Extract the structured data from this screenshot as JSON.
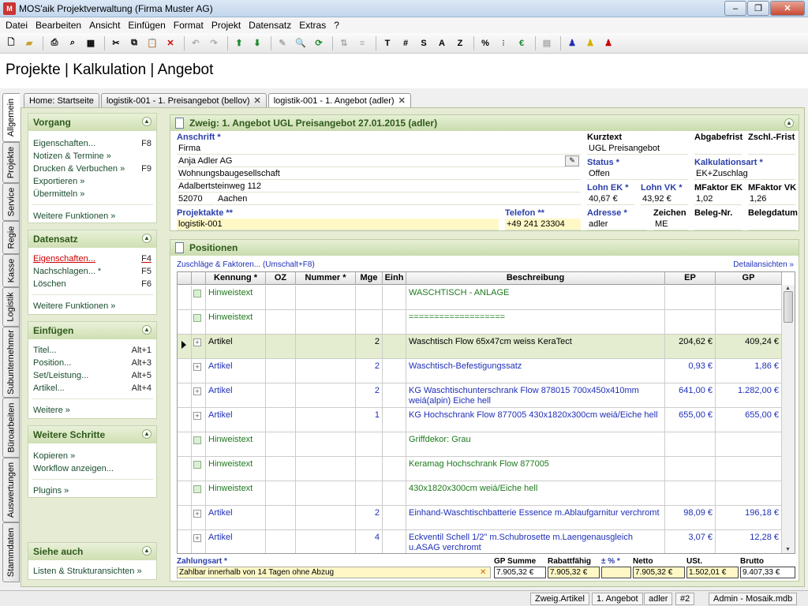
{
  "window": {
    "title": "MOS'aik Projektverwaltung (Firma Muster AG)"
  },
  "menu": [
    "Datei",
    "Bearbeiten",
    "Ansicht",
    "Einfügen",
    "Format",
    "Projekt",
    "Datensatz",
    "Extras",
    "?"
  ],
  "toolbar": {
    "t_btn": "T",
    "hash_btn": "#",
    "s_btn": "S",
    "a_btn": "A",
    "z_btn": "Z",
    "percent_btn": "%"
  },
  "page": {
    "heading": "Projekte | Kalkulation | Angebot"
  },
  "vtabs": [
    "Allgemein",
    "Projekte",
    "Service",
    "Regie",
    "Kasse",
    "Logistik",
    "Subunternehmer",
    "Büroarbeiten",
    "Auswertungen",
    "Stammdaten"
  ],
  "tabs": [
    {
      "label": "Home: Startseite"
    },
    {
      "label": "logistik-001 - 1. Preisangebot (bellov)"
    },
    {
      "label": "logistik-001 - 1. Angebot (adler)"
    }
  ],
  "left": {
    "vorgang": {
      "title": "Vorgang",
      "items": [
        {
          "label": "Eigenschaften...",
          "key": "F8"
        },
        {
          "label": "Notizen & Termine »",
          "key": ""
        },
        {
          "label": "Drucken & Verbuchen »",
          "key": "F9"
        },
        {
          "label": "Exportieren »",
          "key": ""
        },
        {
          "label": "Übermitteln »",
          "key": ""
        }
      ],
      "more": "Weitere Funktionen »"
    },
    "datensatz": {
      "title": "Datensatz",
      "items": [
        {
          "label": "Eigenschaften...",
          "key": "F4"
        },
        {
          "label": "Nachschlagen... *",
          "key": "F5"
        },
        {
          "label": "Löschen",
          "key": "F6"
        }
      ],
      "more": "Weitere Funktionen »"
    },
    "einfuegen": {
      "title": "Einfügen",
      "items": [
        {
          "label": "Titel...",
          "key": "Alt+1"
        },
        {
          "label": "Position...",
          "key": "Alt+3"
        },
        {
          "label": "Set/Leistung...",
          "key": "Alt+5"
        },
        {
          "label": "Artikel...",
          "key": "Alt+4"
        }
      ],
      "more": "Weitere »"
    },
    "schritte": {
      "title": "Weitere Schritte",
      "items": [
        {
          "label": "Kopieren »"
        },
        {
          "label": "Workflow anzeigen..."
        }
      ],
      "more": "Plugins »"
    },
    "siehe": {
      "title": "Siehe auch",
      "items": [
        {
          "label": "Listen & Strukturansichten »"
        }
      ]
    }
  },
  "header": {
    "title": "Zweig: 1. Angebot UGL Preisangebot 27.01.2015 (adler)",
    "anschrift_label": "Anschrift *",
    "anschrift": [
      "Firma",
      "Anja Adler AG",
      "Wohnungsbaugesellschaft",
      "Adalbertsteinweg 112"
    ],
    "plz": "52070",
    "ort": "Aachen",
    "projektakte_label": "Projektakte **",
    "projektakte": "logistik-001",
    "telefon_label": "Telefon **",
    "telefon": "+49 241 23304",
    "kurztext_label": "Kurztext",
    "kurztext": "UGL Preisangebot",
    "abgabefrist_label": "Abgabefrist",
    "zschl_label": "Zschl.-Frist",
    "status_label": "Status *",
    "status": "Offen",
    "kalkart_label": "Kalkulationsart *",
    "kalkart": "EK+Zuschlag",
    "lohn_ek_label": "Lohn EK *",
    "lohn_ek": "40,67 €",
    "lohn_vk_label": "Lohn VK *",
    "lohn_vk": "43,92 €",
    "mf_ek_label": "MFaktor EK",
    "mf_ek": "1,02",
    "mf_vk_label": "MFaktor VK",
    "mf_vk": "1,26",
    "adresse_label": "Adresse *",
    "adresse": "adler",
    "zeichen_label": "Zeichen",
    "zeichen": "ME",
    "belegnr_label": "Beleg-Nr.",
    "belegdatum_label": "Belegdatum"
  },
  "positionen": {
    "title": "Positionen",
    "zuschlaege": "Zuschläge & Faktoren... (Umschalt+F8)",
    "detail": "Detailansichten »",
    "columns": [
      "Kennung *",
      "OZ",
      "Nummer *",
      "Mge",
      "Einh",
      "Beschreibung",
      "EP",
      "GP"
    ],
    "rows": [
      {
        "kennung": "Hinweistext",
        "mge": "",
        "desc": "WASCHTISCH - ANLAGE",
        "ep": "",
        "gp": "",
        "type": "hint"
      },
      {
        "kennung": "Hinweistext",
        "mge": "",
        "desc": "===================",
        "ep": "",
        "gp": "",
        "type": "hint"
      },
      {
        "kennung": "Artikel",
        "mge": "2",
        "desc": "Waschtisch Flow 65x47cm weiss KeraTect",
        "ep": "204,62 €",
        "gp": "409,24 €",
        "type": "sel"
      },
      {
        "kennung": "Artikel",
        "mge": "2",
        "desc": "Waschtisch-Befestigungssatz",
        "ep": "0,93 €",
        "gp": "1,86 €",
        "type": "art"
      },
      {
        "kennung": "Artikel",
        "mge": "2",
        "desc": "KG Waschtischunterschrank Flow 878015 700x450x410mm weiá(alpin) Eiche hell",
        "ep": "641,00 €",
        "gp": "1.282,00 €",
        "type": "art"
      },
      {
        "kennung": "Artikel",
        "mge": "1",
        "desc": "KG Hochschrank Flow 877005 430x1820x300cm weiá/Eiche hell",
        "ep": "655,00 €",
        "gp": "655,00 €",
        "type": "art"
      },
      {
        "kennung": "Hinweistext",
        "mge": "",
        "desc": "Griffdekor: Grau",
        "ep": "",
        "gp": "",
        "type": "hint"
      },
      {
        "kennung": "Hinweistext",
        "mge": "",
        "desc": "Keramag Hochschrank Flow 877005",
        "ep": "",
        "gp": "",
        "type": "hint"
      },
      {
        "kennung": "Hinweistext",
        "mge": "",
        "desc": "430x1820x300cm weiá/Eiche hell",
        "ep": "",
        "gp": "",
        "type": "hint"
      },
      {
        "kennung": "Artikel",
        "mge": "2",
        "desc": "Einhand-Waschtischbatterie Essence m.Ablaufgarnitur verchromt",
        "ep": "98,09 €",
        "gp": "196,18 €",
        "type": "art"
      },
      {
        "kennung": "Artikel",
        "mge": "4",
        "desc": "Eckventil Schell 1/2\" m.Schubrosette m.Laengenausgleich u.ASAG verchromt",
        "ep": "3,07 €",
        "gp": "12,28 €",
        "type": "art"
      }
    ]
  },
  "footer": {
    "zahlungsart_label": "Zahlungsart *",
    "zahlungsart": "Zahlbar innerhalb von 14 Tagen ohne Abzug",
    "gp_summe_label": "GP Summe",
    "gp_summe": "7.905,32 €",
    "rabatt_label": "Rabattfähig",
    "rabatt": "7.905,32 €",
    "pct_label": "± % *",
    "pct": "",
    "netto_label": "Netto",
    "netto": "7.905,32 €",
    "ust_label": "USt.",
    "ust": "1.502,01 €",
    "brutto_label": "Brutto",
    "brutto": "9.407,33 €"
  },
  "status": [
    "Zweig.Artikel",
    "1. Angebot",
    "adler",
    "#2",
    "Admin - Mosaik.mdb"
  ]
}
